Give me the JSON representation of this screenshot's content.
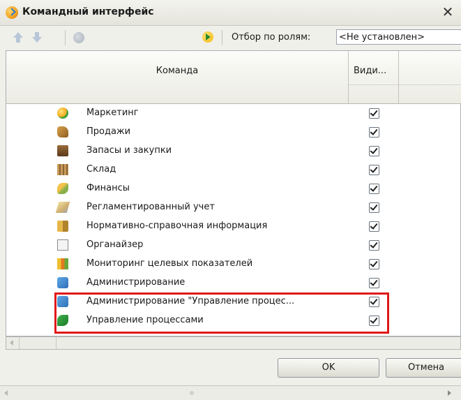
{
  "window": {
    "title": "Командный интерфейс",
    "close_glyph": "✕",
    "title_icon": "wizard-icon"
  },
  "toolbar": {
    "move_up_icon": "arrow-up-icon",
    "move_down_icon": "arrow-down-icon",
    "round_icon": "circle-icon",
    "filter_icon": "apply-filter-icon",
    "filter_label": "Отбор по ролям:",
    "filter_value": "<Не установлен>"
  },
  "table": {
    "columns": [
      "Команда",
      "Види..."
    ],
    "rows": [
      {
        "label": "Маркетинг",
        "checked": true,
        "icon": "marketing-icon"
      },
      {
        "label": "Продажи",
        "checked": true,
        "icon": "sales-icon"
      },
      {
        "label": "Запасы и закупки",
        "checked": true,
        "icon": "inventory-icon"
      },
      {
        "label": "Склад",
        "checked": true,
        "icon": "warehouse-icon"
      },
      {
        "label": "Финансы",
        "checked": true,
        "icon": "finance-icon"
      },
      {
        "label": "Регламентированный учет",
        "checked": true,
        "icon": "regulated-accounting-icon"
      },
      {
        "label": "Нормативно-справочная информация",
        "checked": true,
        "icon": "reference-info-icon"
      },
      {
        "label": "Органайзер",
        "checked": true,
        "icon": "organizer-icon"
      },
      {
        "label": "Мониторинг целевых показателей",
        "checked": true,
        "icon": "monitoring-icon"
      },
      {
        "label": "Администрирование",
        "checked": true,
        "icon": "administration-icon"
      },
      {
        "label": "Администрирование \"Управление процес...",
        "checked": true,
        "icon": "administration-icon"
      },
      {
        "label": "Управление процессами",
        "checked": true,
        "icon": "process-management-icon"
      }
    ]
  },
  "highlight_color": "#e01818",
  "buttons": {
    "ok": "OK",
    "cancel": "Отмена"
  }
}
